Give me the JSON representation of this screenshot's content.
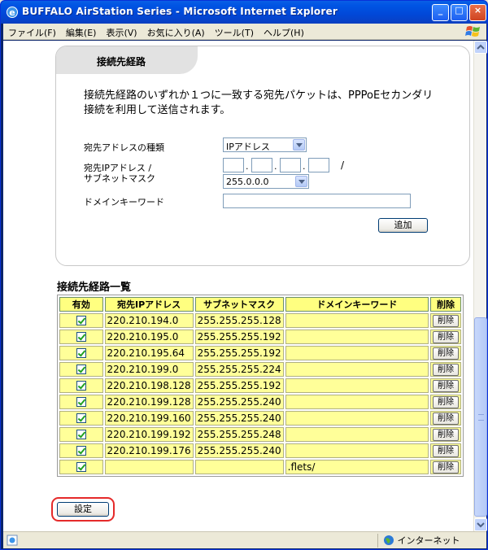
{
  "window": {
    "title": "BUFFALO AirStation Series - Microsoft Internet Explorer",
    "buttons": {
      "minimize": "_",
      "maximize": "□",
      "close": "×"
    }
  },
  "menubar": {
    "items": [
      "ファイル(F)",
      "編集(E)",
      "表示(V)",
      "お気に入り(A)",
      "ツール(T)",
      "ヘルプ(H)"
    ]
  },
  "panel": {
    "tab_title": "接続先経路",
    "description": "接続先経路のいずれか１つに一致する宛先パケットは、PPPoEセカンダリ接続を利用して送信されます。",
    "address_type_label": "宛先アドレスの種類",
    "address_type_value": "IPアドレス",
    "ip_label_line1": "宛先IPアドレス /",
    "ip_label_line2": "サブネットマスク",
    "ip_separator": "/",
    "subnet_value": "255.0.0.0",
    "domain_label": "ドメインキーワード",
    "add_button": "追加"
  },
  "route_list": {
    "title": "接続先経路一覧",
    "headers": [
      "有効",
      "宛先IPアドレス",
      "サブネットマスク",
      "ドメインキーワード",
      "削除"
    ],
    "delete_label": "削除",
    "rows": [
      {
        "ip": "220.210.194.0",
        "mask": "255.255.255.128",
        "domain": ""
      },
      {
        "ip": "220.210.195.0",
        "mask": "255.255.255.192",
        "domain": ""
      },
      {
        "ip": "220.210.195.64",
        "mask": "255.255.255.192",
        "domain": ""
      },
      {
        "ip": "220.210.199.0",
        "mask": "255.255.255.224",
        "domain": ""
      },
      {
        "ip": "220.210.198.128",
        "mask": "255.255.255.192",
        "domain": ""
      },
      {
        "ip": "220.210.199.128",
        "mask": "255.255.255.240",
        "domain": ""
      },
      {
        "ip": "220.210.199.160",
        "mask": "255.255.255.240",
        "domain": ""
      },
      {
        "ip": "220.210.199.192",
        "mask": "255.255.255.248",
        "domain": ""
      },
      {
        "ip": "220.210.199.176",
        "mask": "255.255.255.240",
        "domain": ""
      },
      {
        "ip": "",
        "mask": "",
        "domain": ".flets/"
      }
    ]
  },
  "setup_button": "設定",
  "statusbar": {
    "zone": "インターネット"
  },
  "colors": {
    "table_cell": "#ffff99",
    "highlight_ring": "#e52a2a",
    "title_bar": "#0054e3"
  }
}
